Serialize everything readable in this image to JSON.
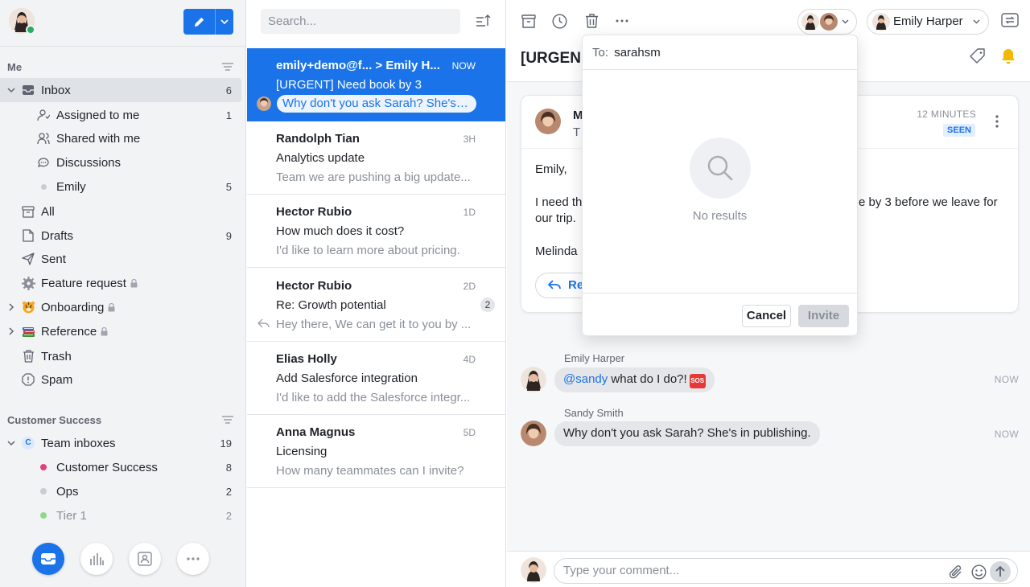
{
  "sidebar": {
    "me_heading": "Me",
    "me_items": [
      {
        "label": "Inbox",
        "count": "6"
      },
      {
        "label": "Assigned to me",
        "count": "1"
      },
      {
        "label": "Shared with me",
        "count": ""
      },
      {
        "label": "Discussions",
        "count": ""
      },
      {
        "label": "Emily",
        "count": "5"
      },
      {
        "label": "All",
        "count": ""
      },
      {
        "label": "Drafts",
        "count": "9"
      },
      {
        "label": "Sent",
        "count": ""
      },
      {
        "label": "Feature request",
        "count": ""
      },
      {
        "label": "Onboarding",
        "count": ""
      },
      {
        "label": "Reference",
        "count": ""
      },
      {
        "label": "Trash",
        "count": ""
      },
      {
        "label": "Spam",
        "count": ""
      }
    ],
    "team_heading": "Customer Success",
    "team_items": [
      {
        "label": "Team inboxes",
        "count": "19",
        "badge": "C"
      },
      {
        "label": "Customer Success",
        "count": "8",
        "color": "#e0417a"
      },
      {
        "label": "Ops",
        "count": "2",
        "color": "#c9ccd1"
      },
      {
        "label": "Tier 1",
        "count": "2",
        "color": "#8fd88a"
      }
    ]
  },
  "list": {
    "search_placeholder": "Search...",
    "messages": [
      {
        "from": "emily+demo@f...  > Emily H...",
        "time": "NOW",
        "subject": "[URGENT] Need book by 3",
        "preview": "Why don't you ask Sarah? She's in ..."
      },
      {
        "from": "Randolph Tian",
        "time": "3H",
        "subject": "Analytics update",
        "preview": "Team we are pushing a big update..."
      },
      {
        "from": "Hector Rubio",
        "time": "1D",
        "subject": "How much does it cost?",
        "preview": "I'd like to learn more about pricing."
      },
      {
        "from": "Hector Rubio",
        "time": "2D",
        "subject": "Re: Growth potential",
        "preview": "Hey there, We can get it to you by ...",
        "count": "2"
      },
      {
        "from": "Elias Holly",
        "time": "4D",
        "subject": "Add Salesforce integration",
        "preview": "I'd like to add the Salesforce integr..."
      },
      {
        "from": "Anna Magnus",
        "time": "5D",
        "subject": "Licensing",
        "preview": "How many teammates can I invite?"
      }
    ]
  },
  "conversation": {
    "title": "[URGEN",
    "user_name": "Emily Harper",
    "email": {
      "from_initial": "M",
      "to_initial": "T",
      "ago": "12 MINUTES",
      "seen": "SEEN",
      "greeting": "Emily,",
      "line1_start": "I need th",
      "line1_end": "e by 3 before we leave for",
      "line2": "our trip.",
      "signature": "Melinda",
      "reply_label": "Re"
    },
    "comments": [
      {
        "author": "Emily Harper",
        "mention": "@sandy",
        "text": " what do I do?!",
        "emoji": "SOS",
        "time": "NOW"
      },
      {
        "author": "Sandy Smith",
        "text": "Why don't you ask Sarah? She's in publishing.",
        "time": "NOW"
      }
    ],
    "composer_placeholder": "Type your comment..."
  },
  "popover": {
    "to_label": "To:",
    "to_value": "sarahsm",
    "empty_text": "No results",
    "cancel_label": "Cancel",
    "invite_label": "Invite"
  },
  "colors": {
    "accent": "#1a73e8",
    "online": "#27ae60",
    "bell": "#f5b800"
  }
}
